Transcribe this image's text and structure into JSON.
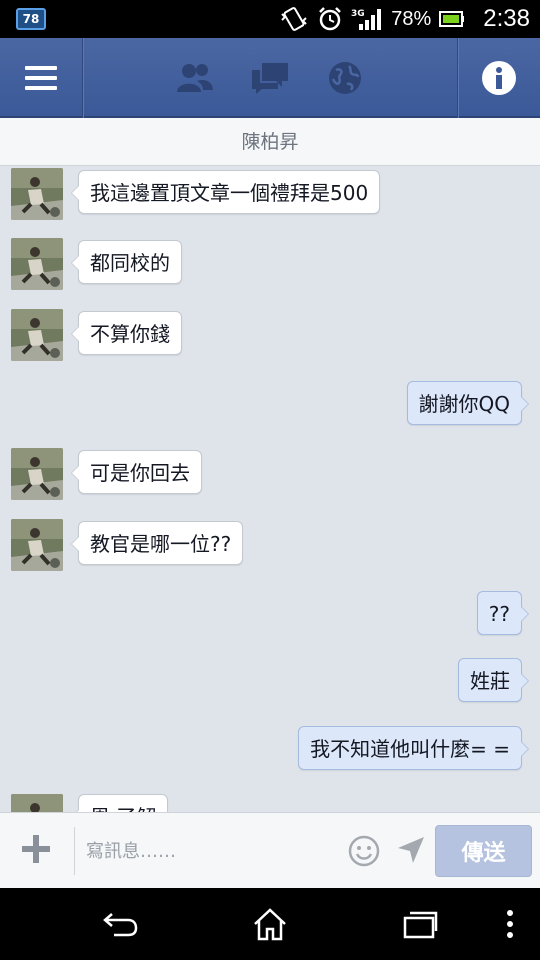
{
  "status_bar": {
    "notification_badge": "78",
    "battery_percent": "78%",
    "network": "3G",
    "time": "2:38"
  },
  "navbar": {
    "menu_icon": "menu-icon",
    "friends_icon": "friends-icon",
    "messages_icon": "messages-icon",
    "notifications_icon": "globe-icon",
    "info_icon": "info-icon"
  },
  "conversation": {
    "contact_name": "陳柏昇"
  },
  "messages": [
    {
      "side": "in",
      "text": "我這邊置頂文章一個禮拜是500"
    },
    {
      "side": "in",
      "text": "都同校的"
    },
    {
      "side": "in",
      "text": "不算你錢"
    },
    {
      "side": "out",
      "text": "謝謝你QQ"
    },
    {
      "side": "in",
      "text": "可是你回去"
    },
    {
      "side": "in",
      "text": "教官是哪一位??"
    },
    {
      "side": "out",
      "text": "??"
    },
    {
      "side": "out",
      "text": "姓莊"
    },
    {
      "side": "out",
      "text": "我不知道他叫什麼= ="
    },
    {
      "side": "in",
      "text": "恩 了解"
    }
  ],
  "compose": {
    "placeholder": "寫訊息……",
    "send_label": "傳送"
  },
  "colors": {
    "fb_blue": "#3b5998",
    "chat_background": "#dfe3ea",
    "outgoing_bubble": "#dce7f9",
    "incoming_bubble": "#ffffff",
    "send_button": "#b5c3e0"
  }
}
